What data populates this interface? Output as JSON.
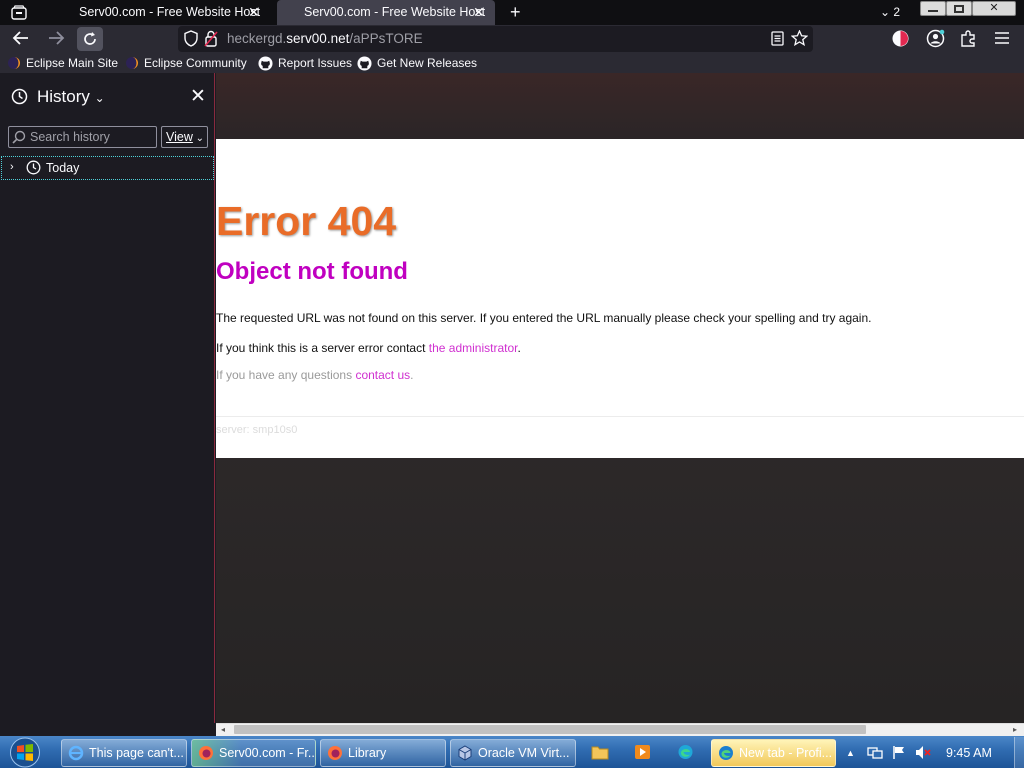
{
  "browser": {
    "tabs": [
      {
        "title": "Serv00.com - Free Website Host",
        "active": false
      },
      {
        "title": "Serv00.com - Free Website Host",
        "active": true
      }
    ],
    "tab_count": "2",
    "new_tab_label": "+",
    "url": {
      "prefix": "heckergd.",
      "domain": "serv00.net",
      "path": "/aPPsTORE"
    },
    "bookmarks": [
      {
        "label": "Eclipse Main Site",
        "icon": "eclipse-icon"
      },
      {
        "label": "Eclipse Community",
        "icon": "eclipse-icon"
      },
      {
        "label": "Report Issues",
        "icon": "github-icon"
      },
      {
        "label": "Get New Releases",
        "icon": "github-icon"
      }
    ]
  },
  "sidebar": {
    "title": "History",
    "search_placeholder": "Search history",
    "view_label": "View",
    "groups": [
      {
        "label": "Today"
      }
    ]
  },
  "page": {
    "heading": "Error 404",
    "subheading": "Object not found",
    "p1": "The requested URL was not found on this server. If you entered the URL manually please check your spelling and try again.",
    "p2_text": "If you think this is a server error contact ",
    "p2_link": "the administrator",
    "p2_end": ".",
    "p3_text": "If you have any questions ",
    "p3_link": "contact us",
    "p3_end": ".",
    "server": "server: smp10s0"
  },
  "taskbar": {
    "items": [
      {
        "label": "This page can't...",
        "icon": "ie-icon"
      },
      {
        "label": "Serv00.com - Fr...",
        "icon": "firefox-icon"
      },
      {
        "label": "Library",
        "icon": "firefox-icon"
      },
      {
        "label": "Oracle VM Virt...",
        "icon": "virtualbox-icon"
      },
      {
        "label": "New tab - Profi...",
        "icon": "edge-icon"
      }
    ],
    "clock": "9:45 AM"
  },
  "colors": {
    "error_heading": "#e96c28",
    "subheading": "#c000c0",
    "link": "#d030d0",
    "focus_outline": "#4fd1d9"
  }
}
